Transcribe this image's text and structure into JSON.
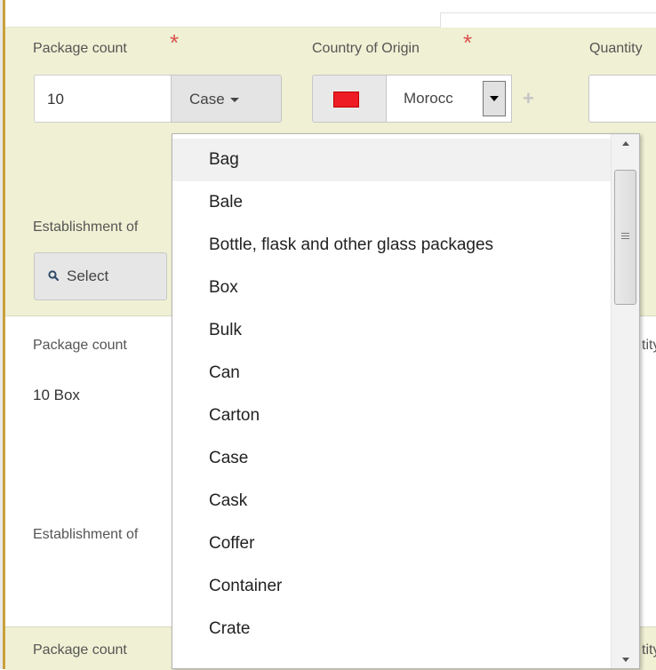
{
  "form_top": {
    "package_count_label": "Package count",
    "package_count_value": "10",
    "package_type_selected": "Case",
    "country_label": "Country of Origin",
    "country_value": "Morocс",
    "quantity_label": "Quantity",
    "establishment_label": "Establishment of",
    "select_label": "Select"
  },
  "form_middle": {
    "package_count_label": "Package count",
    "package_count_value": "10 Box",
    "establishment_label": "Establishment of",
    "quantity_fragment": "tity"
  },
  "form_bottom": {
    "package_count_label": "Package count",
    "quantity_fragment": "tity"
  },
  "dropdown": {
    "items": [
      "Bag",
      "Bale",
      "Bottle, flask and other glass packages",
      "Box",
      "Bulk",
      "Can",
      "Carton",
      "Case",
      "Cask",
      "Coffer",
      "Container",
      "Crate"
    ],
    "hovered_item": "Bag"
  },
  "colors": {
    "section_bg": "#f0f0d4",
    "required": "#d9534f",
    "left_rule": "#c9a13b",
    "flag_red": "#ee1c25"
  },
  "icons": [
    "caret-down-icon",
    "morocco-flag-icon",
    "dropdown-arrow-icon",
    "plus-icon",
    "search-icon",
    "scroll-up-icon",
    "scroll-down-icon",
    "scroll-grip-icon"
  ]
}
